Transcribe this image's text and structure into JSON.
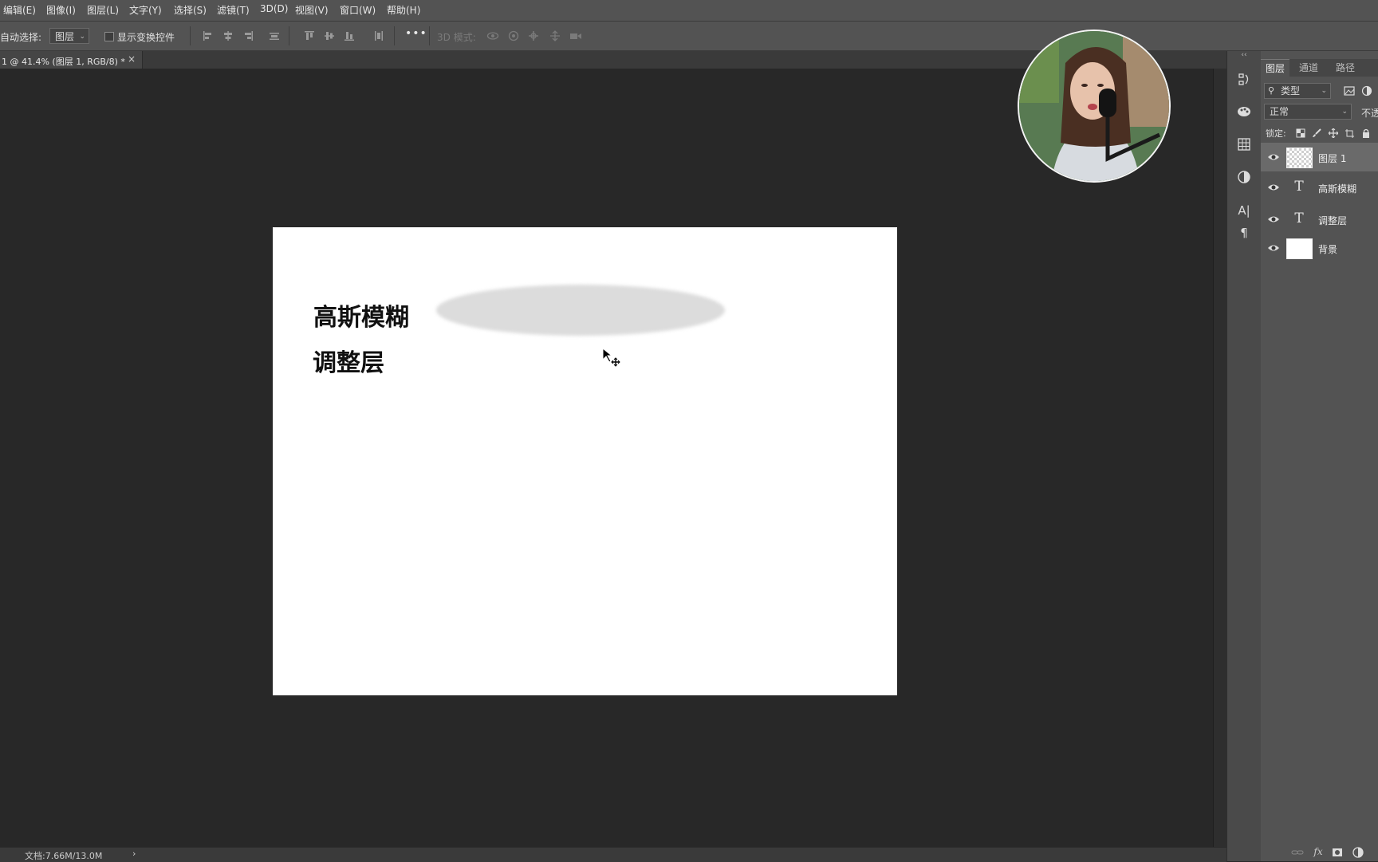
{
  "menu": [
    "编辑(E)",
    "图像(I)",
    "图层(L)",
    "文字(Y)",
    "选择(S)",
    "滤镜(T)",
    "3D(D)",
    "视图(V)",
    "窗口(W)",
    "帮助(H)"
  ],
  "options_bar": {
    "auto_select_label": "自动选择:",
    "auto_select_value": "图层",
    "show_transform_label": "显示变换控件",
    "more_label": "•••",
    "mode3d_label": "3D 模式:"
  },
  "doc_tab": {
    "title": "1 @ 41.4% (图层 1, RGB/8) *",
    "close": "×"
  },
  "document": {
    "line1": "高斯模糊",
    "line2": "调整层"
  },
  "status": {
    "doc_size": "文档:7.66M/13.0M",
    "arrow": "›"
  },
  "layers_panel": {
    "tabs": [
      "图层",
      "通道",
      "路径"
    ],
    "filter_kind": "类型",
    "blend_mode": "正常",
    "opacity_label": "不透",
    "lock_label": "锁定:",
    "layers": [
      {
        "name": "图层 1",
        "type": "pixel",
        "selected": true
      },
      {
        "name": "高斯模糊",
        "type": "text",
        "selected": false
      },
      {
        "name": "调整层",
        "type": "text",
        "selected": false
      },
      {
        "name": "背景",
        "type": "background",
        "selected": false
      }
    ],
    "footer_fx": "fx"
  },
  "colors": {
    "menubar": "#535353",
    "canvas_bg": "#282828",
    "document": "#ffffff",
    "blur_ellipse": "#dcdcdc",
    "selected_layer": "#6a6a6a"
  }
}
